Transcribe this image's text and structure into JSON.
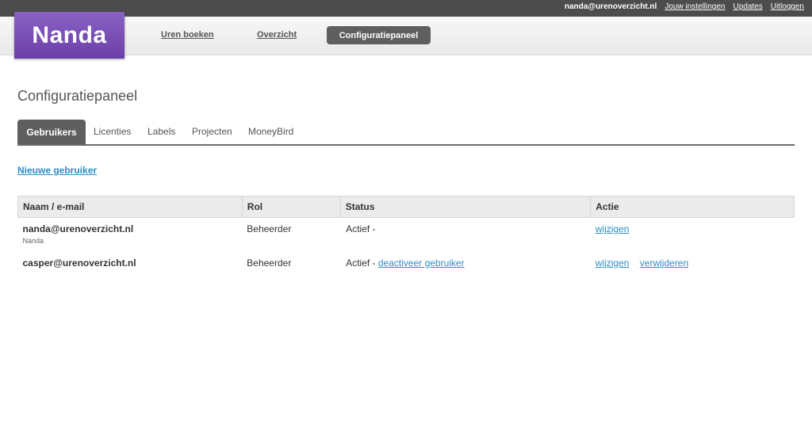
{
  "topbar": {
    "email": "nanda@urenoverzicht.nl",
    "links": [
      "Jouw instellingen",
      "Updates",
      "Uitloggen"
    ]
  },
  "logo": "Nanda",
  "nav": {
    "uren": "Uren boeken",
    "overzicht": "Overzicht",
    "config": "Configuratiepaneel"
  },
  "page_title": "Configuratiepaneel",
  "tabs": [
    "Gebruikers",
    "Licenties",
    "Labels",
    "Projecten",
    "MoneyBird"
  ],
  "new_user": "Nieuwe gebruiker",
  "table": {
    "headers": [
      "Naam / e-mail",
      "Rol",
      "Status",
      "Actie"
    ],
    "rows": [
      {
        "email": "nanda@urenoverzicht.nl",
        "name": "Nanda",
        "role": "Beheerder",
        "status": "Actief -",
        "status_link": "",
        "actions": [
          "wijzigen"
        ]
      },
      {
        "email": "casper@urenoverzicht.nl",
        "name": "",
        "role": "Beheerder",
        "status": "Actief -",
        "status_link": "deactiveer gebruiker",
        "actions": [
          "wijzigen",
          "verwijderen"
        ]
      }
    ]
  },
  "colors": {
    "topbar": "#4c4c4c",
    "logo": "#7b52b9",
    "active": "#5f5f5f",
    "link": "#2a8fc7"
  }
}
